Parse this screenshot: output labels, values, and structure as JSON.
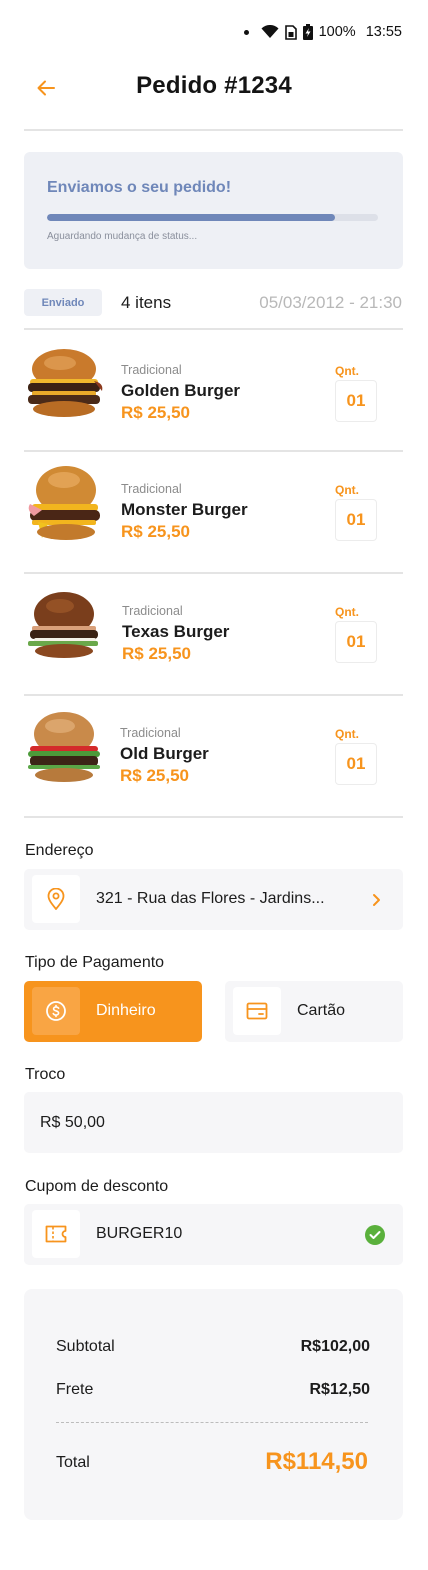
{
  "status_bar": {
    "battery": "100%",
    "time": "13:55"
  },
  "header": {
    "title": "Pedido #1234"
  },
  "order_status": {
    "title": "Enviamos o seu pedido!",
    "progress": 0.87,
    "subtitle": "Aguardando mudança de status..."
  },
  "summary": {
    "badge": "Enviado",
    "item_count": "4 itens",
    "date": "05/03/2012 - 21:30"
  },
  "items": [
    {
      "category": "Tradicional",
      "name": "Golden Burger",
      "price": "R$ 25,50",
      "qnt_label": "Qnt.",
      "qnt": "01"
    },
    {
      "category": "Tradicional",
      "name": "Monster Burger",
      "price": "R$ 25,50",
      "qnt_label": "Qnt.",
      "qnt": "01"
    },
    {
      "category": "Tradicional",
      "name": "Texas Burger",
      "price": "R$ 25,50",
      "qnt_label": "Qnt.",
      "qnt": "01"
    },
    {
      "category": "Tradicional",
      "name": "Old Burger",
      "price": "R$ 25,50",
      "qnt_label": "Qnt.",
      "qnt": "01"
    }
  ],
  "address": {
    "label": "Endereço",
    "value": "321 - Rua das Flores - Jardins..."
  },
  "payment": {
    "label": "Tipo de Pagamento",
    "cash": "Dinheiro",
    "card": "Cartão",
    "selected": "cash"
  },
  "change": {
    "label": "Troco",
    "value": "R$ 50,00"
  },
  "coupon": {
    "label": "Cupom de desconto",
    "value": "BURGER10"
  },
  "totals": {
    "subtotal_label": "Subtotal",
    "subtotal": "R$102,00",
    "shipping_label": "Frete",
    "shipping": "R$12,50",
    "total_label": "Total",
    "total": "R$114,50"
  },
  "colors": {
    "accent": "#f7941d",
    "status_blue": "#6f87b9",
    "success": "#5ab03c"
  }
}
